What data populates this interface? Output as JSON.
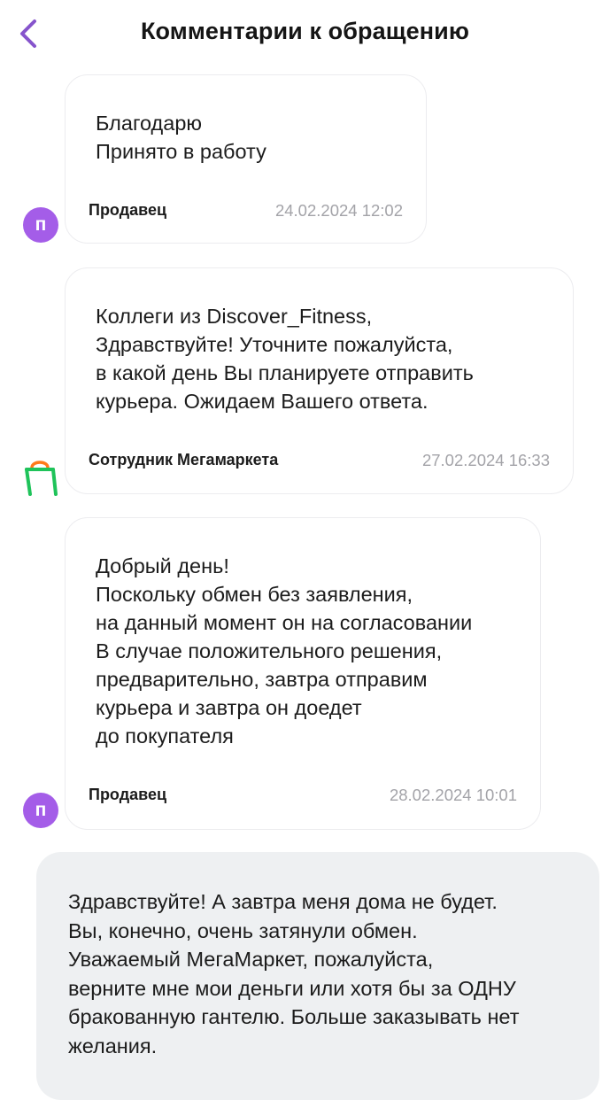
{
  "header": {
    "title": "Комментарии к обращению",
    "back_icon": "chevron-left-icon",
    "accent_color": "#8654cc"
  },
  "comments": [
    {
      "text": "Благодарю\nПринято в работу",
      "author": "Продавец",
      "timestamp": "24.02.2024 12:02",
      "avatar_letter": "п"
    },
    {
      "text": "Коллеги из Discover_Fitness,\nЗдравствуйте! Уточните пожалуйста,\nв какой день Вы планируете отправить\nкурьера. Ожидаем Вашего ответа.",
      "author": "Сотрудник Мегамаркета",
      "timestamp": "27.02.2024 16:33",
      "avatar_icon": "megamarket-bag-icon"
    },
    {
      "text": "Добрый день!\nПоскольку обмен без заявления,\nна данный момент он на согласовании\nВ случае положительного решения,\nпредварительно, завтра отправим\nкурьера и завтра он доедет\nдо покупателя",
      "author": "Продавец",
      "timestamp": "28.02.2024 10:01",
      "avatar_letter": "п"
    }
  ],
  "user_message": {
    "text": "Здравствуйте! А завтра меня дома не будет.\nВы, конечно, очень затянули обмен.\nУважаемый МегаМаркет, пожалуйста,\nверните мне мои деньги или хотя бы за ОДНУ\nбракованную гантелю. Больше заказывать нет\nжелания."
  },
  "colors": {
    "seller_avatar": "#a45de8",
    "user_bubble": "#eef0f2",
    "timestamp": "#a3a3a8"
  }
}
